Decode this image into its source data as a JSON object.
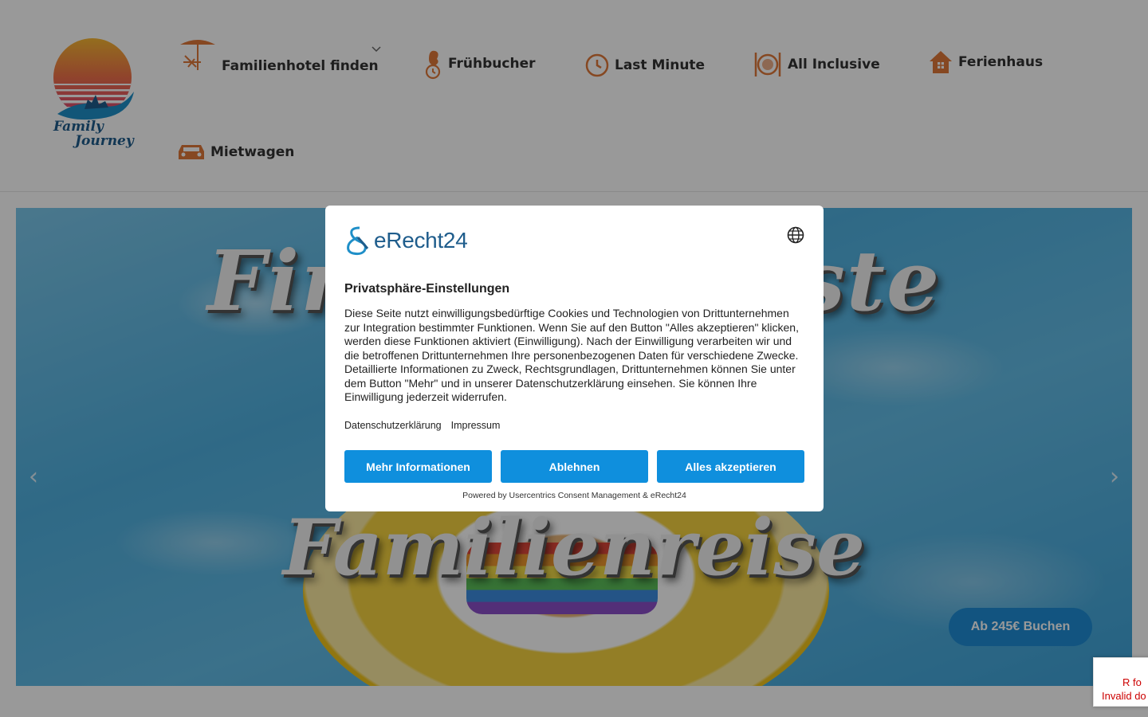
{
  "logo": {
    "line1": "Family",
    "line2": "Journey"
  },
  "nav": {
    "items": [
      {
        "label": "Familienhotel finden",
        "icon": "beach-chair-icon"
      },
      {
        "label": "Frühbucher",
        "icon": "early-bird-icon"
      },
      {
        "label": "Last Minute",
        "icon": "clock-icon"
      },
      {
        "label": "All Inclusive",
        "icon": "plate-cutlery-icon"
      },
      {
        "label": "Ferienhaus",
        "icon": "house-icon"
      },
      {
        "label": "Mietwagen",
        "icon": "car-icon"
      }
    ]
  },
  "hero": {
    "title_line1": "Finde die beste",
    "title_line2": "Familienreise",
    "book_button": "Ab 245€ Buchen"
  },
  "consent": {
    "brand": "eRecht24",
    "title": "Privatsphäre-Einstellungen",
    "body": "Diese Seite nutzt einwilligungsbedürftige Cookies und Technologien von Drittunternehmen zur Integration bestimmter Funktionen. Wenn Sie auf den Button \"Alles akzeptieren\" klicken, werden diese Funktionen aktiviert (Einwilligung). Nach der Einwilligung verarbeiten wir und die betroffenen Drittunternehmen Ihre personenbezogenen Daten für verschiedene Zwecke. Detaillierte Informationen zu Zweck, Rechtsgrundlagen, Drittunternehmen können Sie unter dem Button \"Mehr\" und in unserer Datenschutzerklärung einsehen. Sie können Ihre Einwilligung jederzeit widerrufen.",
    "link_privacy": "Datenschutzerklärung",
    "link_imprint": "Impressum",
    "btn_more": "Mehr Informationen",
    "btn_decline": "Ablehnen",
    "btn_accept": "Alles akzeptieren",
    "powered_by": "Powered by Usercentrics Consent Management & eRecht24"
  },
  "recaptcha": {
    "line1": "R fo",
    "line2": "Invalid do"
  },
  "colors": {
    "accent": "#0f8fdd",
    "nav_icon": "#e0783a",
    "logo_blue": "#1f5d8c"
  }
}
